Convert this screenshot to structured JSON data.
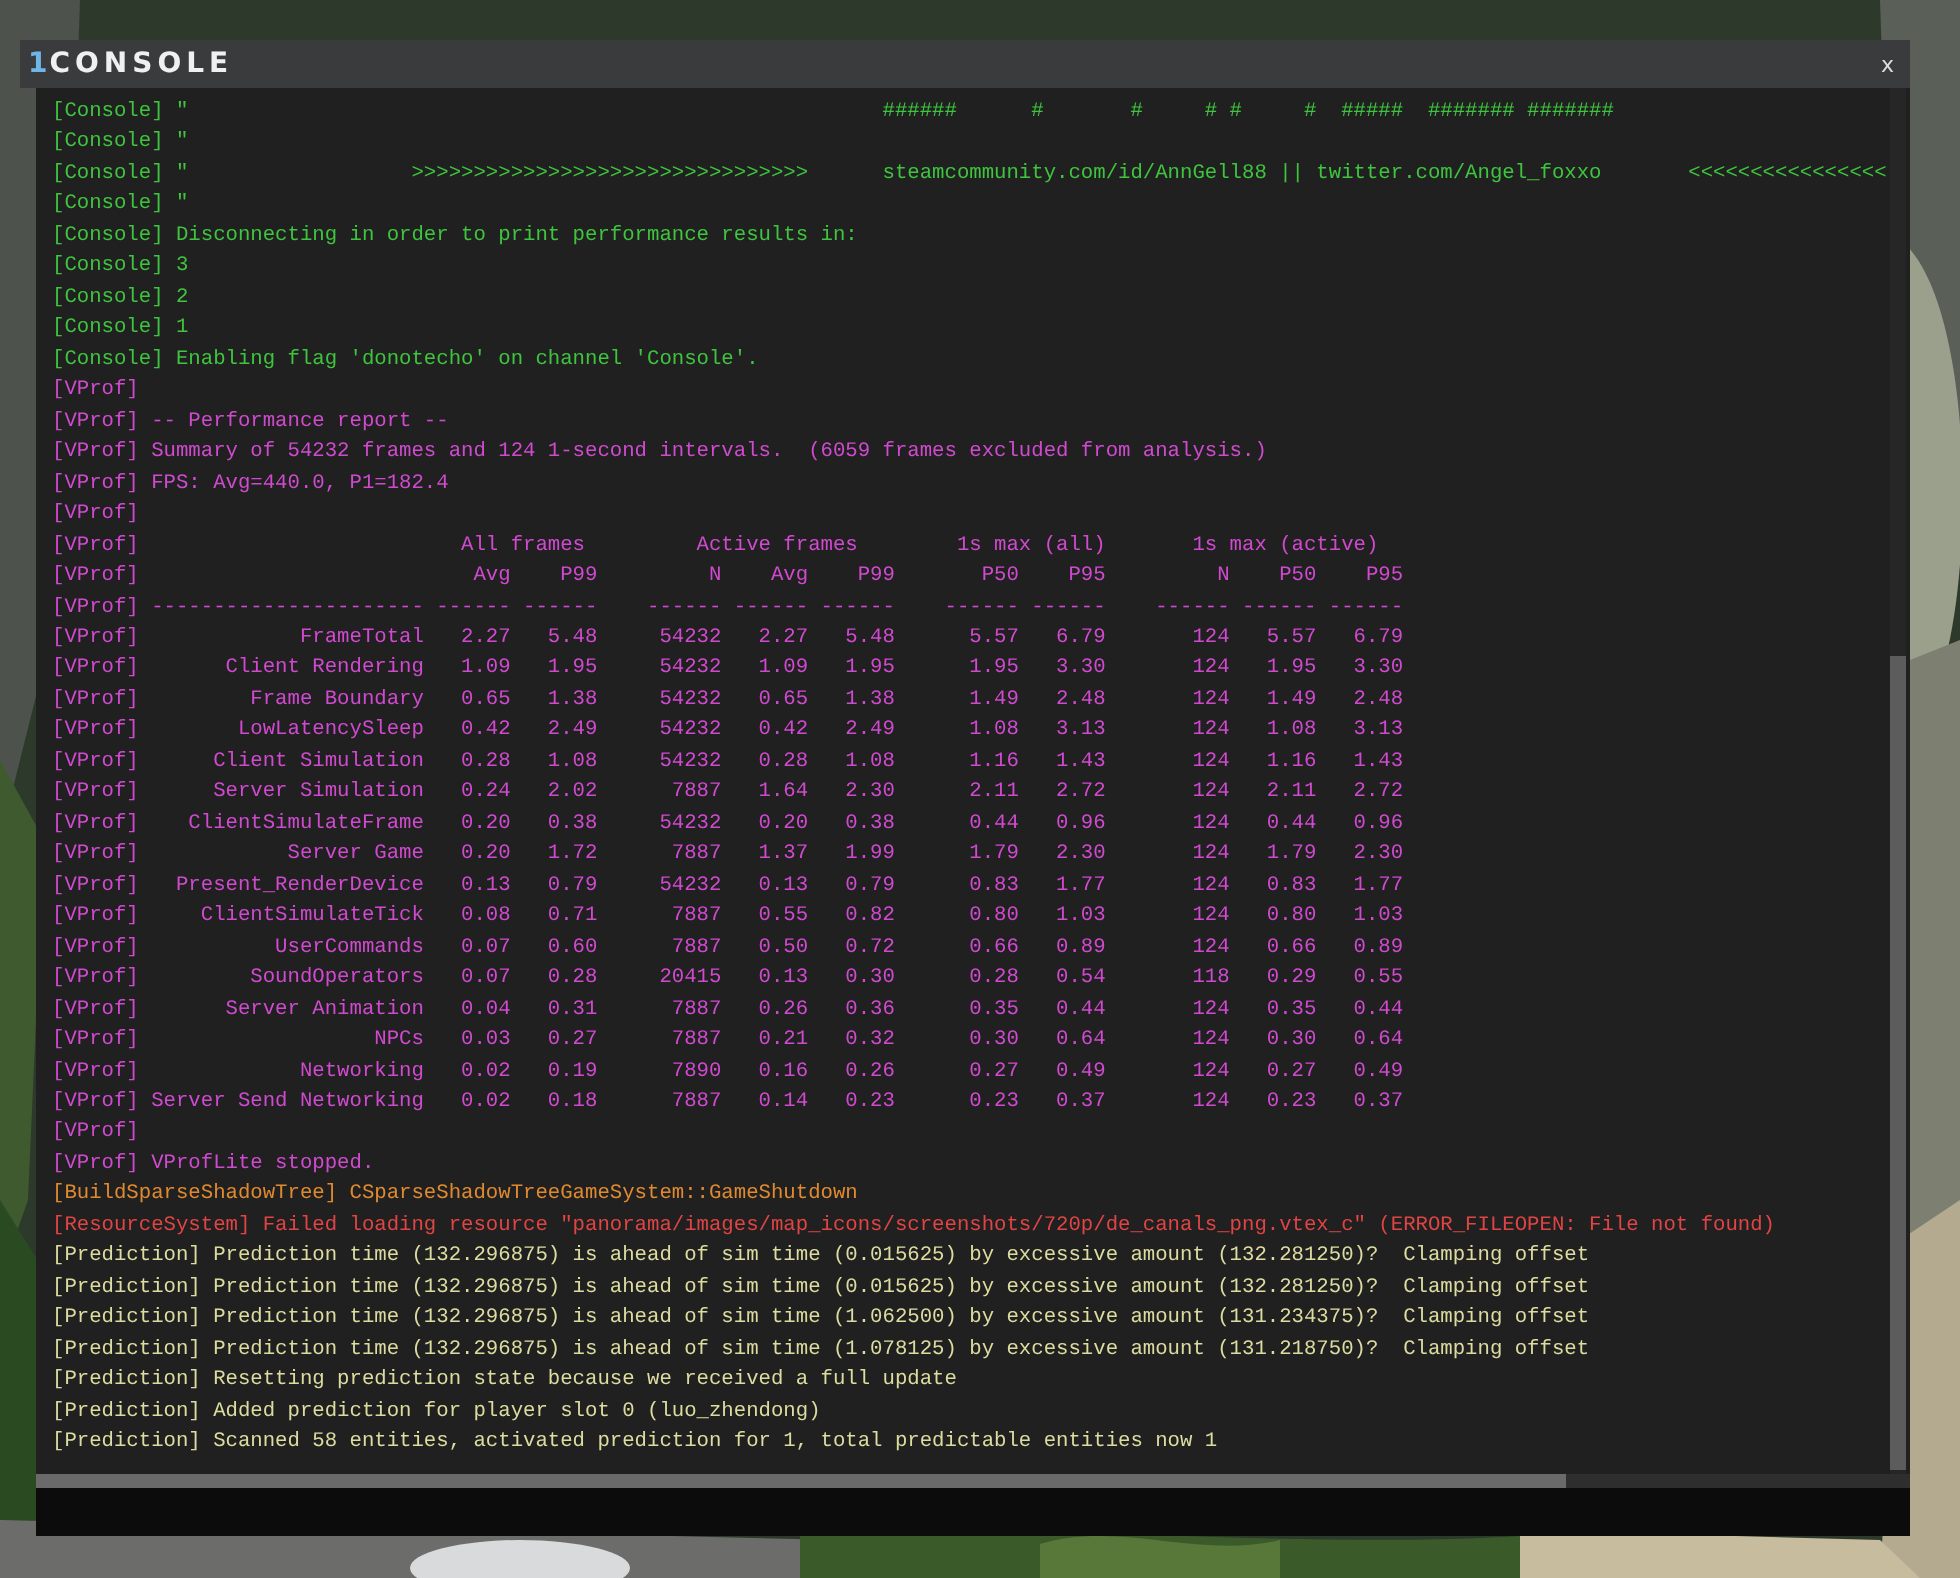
{
  "window": {
    "number": "1",
    "title": "CONSOLE",
    "close": "x"
  },
  "log": [
    {
      "kind": "text",
      "color": "#3ec43e",
      "text": "[Console] \"                                                        ######      #       #     # #     #  #####  ####### #######"
    },
    {
      "kind": "text",
      "color": "#3ec43e",
      "text": "[Console] \""
    },
    {
      "kind": "text",
      "color": "#3ec43e",
      "text": "[Console] \"                  >>>>>>>>>>>>>>>>>>>>>>>>>>>>>>>>      steamcommunity.com/id/AnnGell88 || twitter.com/Angel_foxxo       <<<<<<<<<<<<<<<<"
    },
    {
      "kind": "text",
      "color": "#3ec43e",
      "text": "[Console] \""
    },
    {
      "kind": "text",
      "color": "#3ec43e",
      "text": "[Console] Disconnecting in order to print performance results in:"
    },
    {
      "kind": "text",
      "color": "#3ec43e",
      "text": "[Console] 3"
    },
    {
      "kind": "text",
      "color": "#3ec43e",
      "text": "[Console] 2"
    },
    {
      "kind": "text",
      "color": "#3ec43e",
      "text": "[Console] 1"
    },
    {
      "kind": "text",
      "color": "#3ec43e",
      "text": "[Console] Enabling flag 'donotecho' on channel 'Console'."
    },
    {
      "kind": "text",
      "color": "#d04ad0",
      "text": "[VProf]"
    },
    {
      "kind": "text",
      "color": "#d04ad0",
      "text": "[VProf] -- Performance report --"
    },
    {
      "kind": "text",
      "color": "#d04ad0",
      "text": "[VProf] Summary of 54232 frames and 124 1-second intervals.  (6059 frames excluded from analysis.)"
    },
    {
      "kind": "text",
      "color": "#d04ad0",
      "text": "[VProf] FPS: Avg=440.0, P1=182.4"
    },
    {
      "kind": "text",
      "color": "#d04ad0",
      "text": "[VProf]"
    },
    {
      "kind": "table_groups",
      "color": "#d04ad0",
      "tag": "[VProf]",
      "groups": [
        "All frames",
        "Active frames",
        "1s max (all)",
        "1s max (active)"
      ]
    },
    {
      "kind": "table_row",
      "color": "#d04ad0",
      "tag": "[VProf]",
      "cells": [
        "Avg",
        "P99",
        "N",
        "Avg",
        "P99",
        "P50",
        "P95",
        "N",
        "P50",
        "P95"
      ]
    },
    {
      "kind": "table_row",
      "color": "#d04ad0",
      "tag": "[VProf]",
      "name": "----------------------",
      "cells": [
        "------",
        "------",
        "------",
        "------",
        "------",
        "------",
        "------",
        "------",
        "------",
        "------"
      ]
    },
    {
      "kind": "table_row",
      "color": "#d04ad0",
      "tag": "[VProf]",
      "name": "FrameTotal",
      "cells": [
        "2.27",
        "5.48",
        "54232",
        "2.27",
        "5.48",
        "5.57",
        "6.79",
        "124",
        "5.57",
        "6.79"
      ]
    },
    {
      "kind": "table_row",
      "color": "#d04ad0",
      "tag": "[VProf]",
      "name": "Client Rendering",
      "cells": [
        "1.09",
        "1.95",
        "54232",
        "1.09",
        "1.95",
        "1.95",
        "3.30",
        "124",
        "1.95",
        "3.30"
      ]
    },
    {
      "kind": "table_row",
      "color": "#d04ad0",
      "tag": "[VProf]",
      "name": "Frame Boundary",
      "cells": [
        "0.65",
        "1.38",
        "54232",
        "0.65",
        "1.38",
        "1.49",
        "2.48",
        "124",
        "1.49",
        "2.48"
      ]
    },
    {
      "kind": "table_row",
      "color": "#d04ad0",
      "tag": "[VProf]",
      "name": "LowLatencySleep",
      "cells": [
        "0.42",
        "2.49",
        "54232",
        "0.42",
        "2.49",
        "1.08",
        "3.13",
        "124",
        "1.08",
        "3.13"
      ]
    },
    {
      "kind": "table_row",
      "color": "#d04ad0",
      "tag": "[VProf]",
      "name": "Client Simulation",
      "cells": [
        "0.28",
        "1.08",
        "54232",
        "0.28",
        "1.08",
        "1.16",
        "1.43",
        "124",
        "1.16",
        "1.43"
      ]
    },
    {
      "kind": "table_row",
      "color": "#d04ad0",
      "tag": "[VProf]",
      "name": "Server Simulation",
      "cells": [
        "0.24",
        "2.02",
        "7887",
        "1.64",
        "2.30",
        "2.11",
        "2.72",
        "124",
        "2.11",
        "2.72"
      ]
    },
    {
      "kind": "table_row",
      "color": "#d04ad0",
      "tag": "[VProf]",
      "name": "ClientSimulateFrame",
      "cells": [
        "0.20",
        "0.38",
        "54232",
        "0.20",
        "0.38",
        "0.44",
        "0.96",
        "124",
        "0.44",
        "0.96"
      ]
    },
    {
      "kind": "table_row",
      "color": "#d04ad0",
      "tag": "[VProf]",
      "name": "Server Game",
      "cells": [
        "0.20",
        "1.72",
        "7887",
        "1.37",
        "1.99",
        "1.79",
        "2.30",
        "124",
        "1.79",
        "2.30"
      ]
    },
    {
      "kind": "table_row",
      "color": "#d04ad0",
      "tag": "[VProf]",
      "name": "Present_RenderDevice",
      "cells": [
        "0.13",
        "0.79",
        "54232",
        "0.13",
        "0.79",
        "0.83",
        "1.77",
        "124",
        "0.83",
        "1.77"
      ]
    },
    {
      "kind": "table_row",
      "color": "#d04ad0",
      "tag": "[VProf]",
      "name": "ClientSimulateTick",
      "cells": [
        "0.08",
        "0.71",
        "7887",
        "0.55",
        "0.82",
        "0.80",
        "1.03",
        "124",
        "0.80",
        "1.03"
      ]
    },
    {
      "kind": "table_row",
      "color": "#d04ad0",
      "tag": "[VProf]",
      "name": "UserCommands",
      "cells": [
        "0.07",
        "0.60",
        "7887",
        "0.50",
        "0.72",
        "0.66",
        "0.89",
        "124",
        "0.66",
        "0.89"
      ]
    },
    {
      "kind": "table_row",
      "color": "#d04ad0",
      "tag": "[VProf]",
      "name": "SoundOperators",
      "cells": [
        "0.07",
        "0.28",
        "20415",
        "0.13",
        "0.30",
        "0.28",
        "0.54",
        "118",
        "0.29",
        "0.55"
      ]
    },
    {
      "kind": "table_row",
      "color": "#d04ad0",
      "tag": "[VProf]",
      "name": "Server Animation",
      "cells": [
        "0.04",
        "0.31",
        "7887",
        "0.26",
        "0.36",
        "0.35",
        "0.44",
        "124",
        "0.35",
        "0.44"
      ]
    },
    {
      "kind": "table_row",
      "color": "#d04ad0",
      "tag": "[VProf]",
      "name": "NPCs",
      "cells": [
        "0.03",
        "0.27",
        "7887",
        "0.21",
        "0.32",
        "0.30",
        "0.64",
        "124",
        "0.30",
        "0.64"
      ]
    },
    {
      "kind": "table_row",
      "color": "#d04ad0",
      "tag": "[VProf]",
      "name": "Networking",
      "cells": [
        "0.02",
        "0.19",
        "7890",
        "0.16",
        "0.26",
        "0.27",
        "0.49",
        "124",
        "0.27",
        "0.49"
      ]
    },
    {
      "kind": "table_row",
      "color": "#d04ad0",
      "tag": "[VProf]",
      "name": "Server Send Networking",
      "cells": [
        "0.02",
        "0.18",
        "7887",
        "0.14",
        "0.23",
        "0.23",
        "0.37",
        "124",
        "0.23",
        "0.37"
      ]
    },
    {
      "kind": "text",
      "color": "#d04ad0",
      "text": "[VProf]"
    },
    {
      "kind": "text",
      "color": "#d04ad0",
      "text": "[VProf] VProfLite stopped."
    },
    {
      "kind": "text",
      "color": "#e08a30",
      "text": "[BuildSparseShadowTree] CSparseShadowTreeGameSystem::GameShutdown"
    },
    {
      "kind": "text",
      "color": "#e04444",
      "text": "[ResourceSystem] Failed loading resource \"panorama/images/map_icons/screenshots/720p/de_canals_png.vtex_c\" (ERROR_FILEOPEN: File not found)"
    },
    {
      "kind": "text",
      "color": "#dcdca0",
      "text": "[Prediction] Prediction time (132.296875) is ahead of sim time (0.015625) by excessive amount (132.281250)?  Clamping offset"
    },
    {
      "kind": "text",
      "color": "#dcdca0",
      "text": "[Prediction] Prediction time (132.296875) is ahead of sim time (0.015625) by excessive amount (132.281250)?  Clamping offset"
    },
    {
      "kind": "text",
      "color": "#dcdca0",
      "text": "[Prediction] Prediction time (132.296875) is ahead of sim time (1.062500) by excessive amount (131.234375)?  Clamping offset"
    },
    {
      "kind": "text",
      "color": "#dcdca0",
      "text": "[Prediction] Prediction time (132.296875) is ahead of sim time (1.078125) by excessive amount (131.218750)?  Clamping offset"
    },
    {
      "kind": "text",
      "color": "#dcdca0",
      "text": "[Prediction] Resetting prediction state because we received a full update"
    },
    {
      "kind": "text",
      "color": "#dcdca0",
      "text": "[Prediction] Added prediction for player slot 0 (luo_zhendong)"
    },
    {
      "kind": "text",
      "color": "#dcdca0",
      "text": "[Prediction] Scanned 58 entities, activated prediction for 1, total predictable entities now 1"
    }
  ]
}
